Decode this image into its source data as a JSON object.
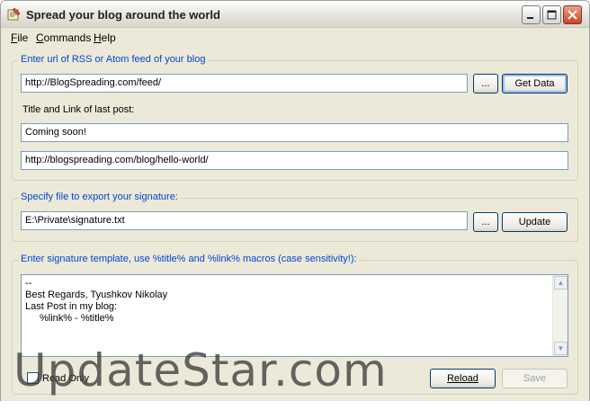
{
  "window": {
    "title": "Spread your blog around the world"
  },
  "menu": {
    "file": {
      "mnemonic": "F",
      "rest": "ile"
    },
    "commands": {
      "mnemonic": "C",
      "rest": "ommands"
    },
    "help": {
      "mnemonic": "H",
      "rest": "elp"
    }
  },
  "feed_group": {
    "legend": "Enter url of RSS or Atom feed of your blog",
    "url_value": "http://BlogSpreading.com/feed/",
    "browse_label": "...",
    "get_data_label": "Get Data",
    "last_post_label": "Title and Link of last post:",
    "title_value": "Coming soon!",
    "link_value": "http://blogspreading.com/blog/hello-world/"
  },
  "export_group": {
    "legend": "Specify file to export your signature:",
    "path_value": "E:\\Private\\signature.txt",
    "browse_label": "...",
    "update_label": "Update"
  },
  "template_group": {
    "legend": "Enter signature template, use %title% and %link% macros (case sensitivity!):",
    "lines": [
      "--",
      "Best Regards, Tyushkov Nikolay",
      "Last Post in my blog:",
      "    %link% - %title%"
    ],
    "read_only_label": "Read Only",
    "read_only_checked": false,
    "reload_label": "Reload",
    "save_label": "Save"
  },
  "watermark": "UpdateStar.com",
  "colors": {
    "legend": "#0046d5",
    "window_bg": "#ece9d8",
    "field_border": "#7f9db9"
  }
}
